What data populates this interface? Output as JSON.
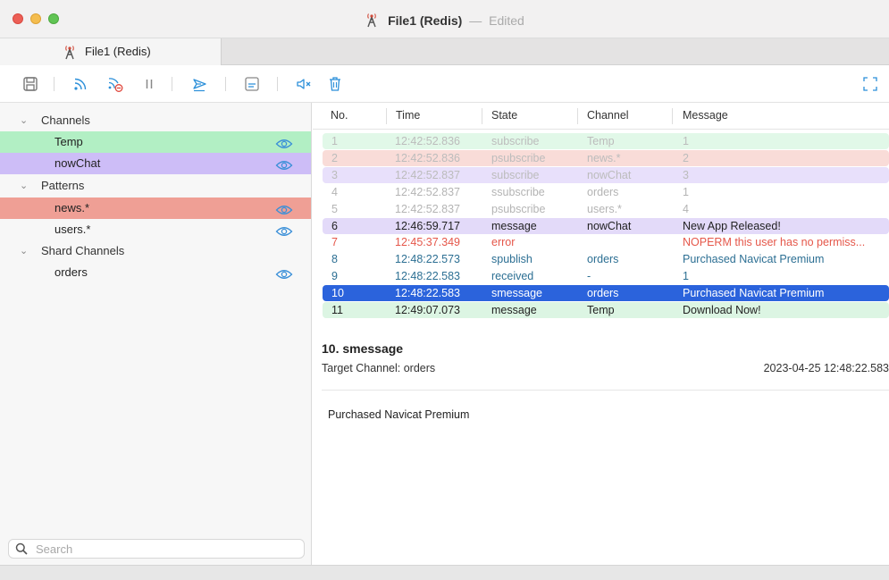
{
  "window": {
    "title": "File1 (Redis)",
    "separator": "—",
    "status": "Edited"
  },
  "tab": {
    "label": "File1 (Redis)"
  },
  "toolbar": {
    "icons": [
      "save-icon",
      "subscribe-icon",
      "unsubscribe-icon",
      "pause-icon",
      "publish-icon",
      "message-panel-icon",
      "mute-icon",
      "trash-icon",
      "fullscreen-icon"
    ]
  },
  "sidebar": {
    "groups": [
      {
        "label": "Channels",
        "items": [
          {
            "label": "Temp",
            "color": "#b2efc4"
          },
          {
            "label": "nowChat",
            "color": "#cdbdf7"
          }
        ]
      },
      {
        "label": "Patterns",
        "items": [
          {
            "label": "news.*",
            "color": "#ef9f95"
          },
          {
            "label": "users.*",
            "color": ""
          }
        ]
      },
      {
        "label": "Shard Channels",
        "items": [
          {
            "label": "orders",
            "color": ""
          }
        ]
      }
    ],
    "search": {
      "placeholder": "Search",
      "value": ""
    }
  },
  "table": {
    "columns": [
      "No.",
      "Time",
      "State",
      "Channel",
      "Message"
    ],
    "rows": [
      {
        "no": "1",
        "time": "12:42:52.836",
        "state": "subscribe",
        "channel": "Temp",
        "message": "1",
        "bg": "#e1f8e8",
        "fg": "#bcbcbc"
      },
      {
        "no": "2",
        "time": "12:42:52.836",
        "state": "psubscribe",
        "channel": "news.*",
        "message": "2",
        "bg": "#f9dcd8",
        "fg": "#bcbcbc"
      },
      {
        "no": "3",
        "time": "12:42:52.837",
        "state": "subscribe",
        "channel": "nowChat",
        "message": "3",
        "bg": "#e8e0fb",
        "fg": "#bcbcbc"
      },
      {
        "no": "4",
        "time": "12:42:52.837",
        "state": "ssubscribe",
        "channel": "orders",
        "message": "1",
        "bg": "",
        "fg": "#b4b4b4"
      },
      {
        "no": "5",
        "time": "12:42:52.837",
        "state": "psubscribe",
        "channel": "users.*",
        "message": "4",
        "bg": "",
        "fg": "#b4b4b4"
      },
      {
        "no": "6",
        "time": "12:46:59.717",
        "state": "message",
        "channel": "nowChat",
        "message": "New App Released!",
        "bg": "#e3daf9",
        "fg": "#222222"
      },
      {
        "no": "7",
        "time": "12:45:37.349",
        "state": "error",
        "channel": "",
        "message": "NOPERM this user has no permiss...",
        "bg": "",
        "fg": "#e5574a"
      },
      {
        "no": "8",
        "time": "12:48:22.573",
        "state": "spublish",
        "channel": "orders",
        "message": "Purchased Navicat Premium",
        "bg": "",
        "fg": "#2c6f93"
      },
      {
        "no": "9",
        "time": "12:48:22.583",
        "state": "received",
        "channel": "-",
        "message": "1",
        "bg": "",
        "fg": "#2c6f93"
      },
      {
        "no": "10",
        "time": "12:48:22.583",
        "state": "smessage",
        "channel": "orders",
        "message": "Purchased Navicat Premium",
        "bg": "#2b63dc",
        "fg": "#ffffff"
      },
      {
        "no": "11",
        "time": "12:49:07.073",
        "state": "message",
        "channel": "Temp",
        "message": "Download Now!",
        "bg": "#dcf5e3",
        "fg": "#222222"
      }
    ]
  },
  "detail": {
    "title": "10. smessage",
    "target": "Target Channel: orders",
    "timestamp": "2023-04-25 12:48:22.583",
    "body": "Purchased Navicat Premium"
  },
  "colors": {
    "selection": "#2b63dc",
    "eye_icon": "#3a8fd8"
  }
}
